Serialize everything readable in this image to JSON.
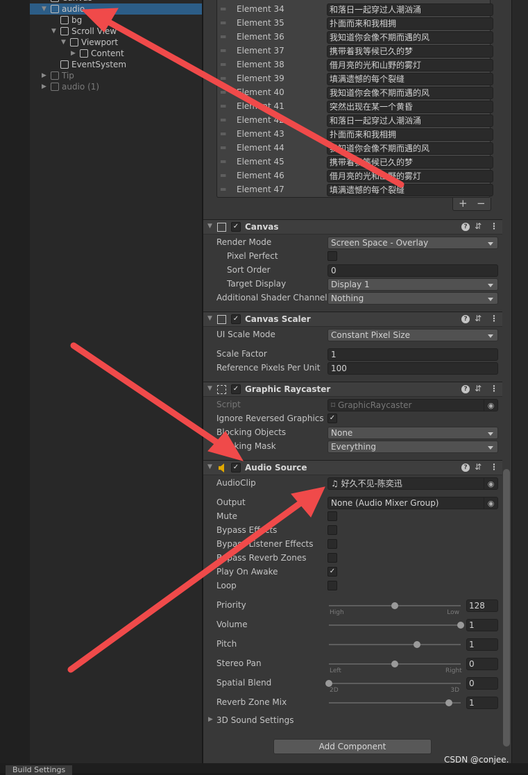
{
  "hierarchy": {
    "items": [
      {
        "label": "Canvas",
        "depth": 0,
        "fold": "open",
        "dim": false
      },
      {
        "label": "audio",
        "depth": 0,
        "fold": "open",
        "selected": true,
        "dim": false
      },
      {
        "label": "bg",
        "depth": 1,
        "fold": "none",
        "dim": false
      },
      {
        "label": "Scroll View",
        "depth": 1,
        "fold": "open",
        "dim": false
      },
      {
        "label": "Viewport",
        "depth": 2,
        "fold": "open",
        "dim": false
      },
      {
        "label": "Content",
        "depth": 3,
        "fold": "closed",
        "dim": false
      },
      {
        "label": "EventSystem",
        "depth": 1,
        "fold": "none",
        "dim": false
      },
      {
        "label": "Tip",
        "depth": 0,
        "fold": "closed",
        "dim": true
      },
      {
        "label": "audio (1)",
        "depth": 0,
        "fold": "closed",
        "dim": true
      }
    ]
  },
  "list": {
    "elements": [
      {
        "label": "Element 34",
        "value": "和落日一起穿过人潮汹涌"
      },
      {
        "label": "Element 35",
        "value": "扑面而来和我相拥"
      },
      {
        "label": "Element 36",
        "value": "我知道你会像不期而遇的风"
      },
      {
        "label": "Element 37",
        "value": "携带着我等候已久的梦"
      },
      {
        "label": "Element 38",
        "value": "借月亮的光和山野的雾灯"
      },
      {
        "label": "Element 39",
        "value": "填满遗憾的每个裂缝"
      },
      {
        "label": "Element 40",
        "value": "我知道你会像不期而遇的风"
      },
      {
        "label": "Element 41",
        "value": "突然出现在某一个黄昏"
      },
      {
        "label": "Element 42",
        "value": "和落日一起穿过人潮汹涌"
      },
      {
        "label": "Element 43",
        "value": "扑面而来和我相拥"
      },
      {
        "label": "Element 44",
        "value": "我知道你会像不期而遇的风"
      },
      {
        "label": "Element 45",
        "value": "携带着我等候已久的梦"
      },
      {
        "label": "Element 46",
        "value": "借月亮的光和山野的雾灯"
      },
      {
        "label": "Element 47",
        "value": "填满遗憾的每个裂缝"
      }
    ],
    "add_label": "+",
    "remove_label": "−"
  },
  "components": [
    {
      "title": "Canvas",
      "icon": "canvas-icon",
      "enabled": true,
      "props": [
        {
          "label": "Render Mode",
          "type": "dropdown",
          "value": "Screen Space - Overlay"
        },
        {
          "label": "Pixel Perfect",
          "type": "checkbox",
          "checked": false,
          "indent": true
        },
        {
          "label": "Sort Order",
          "type": "text",
          "value": "0",
          "indent": true
        },
        {
          "label": "Target Display",
          "type": "dropdown",
          "value": "Display 1",
          "indent": true
        },
        {
          "label": "Additional Shader Channels",
          "type": "dropdown",
          "value": "Nothing"
        }
      ]
    },
    {
      "title": "Canvas Scaler",
      "icon": "canvas-scaler-icon",
      "enabled": true,
      "props": [
        {
          "label": "UI Scale Mode",
          "type": "dropdown",
          "value": "Constant Pixel Size"
        },
        {
          "label": "Scale Factor",
          "type": "text",
          "value": "1"
        },
        {
          "label": "Reference Pixels Per Unit",
          "type": "text",
          "value": "100"
        }
      ]
    },
    {
      "title": "Graphic Raycaster",
      "icon": "graphic-raycaster-icon",
      "enabled": true,
      "props": [
        {
          "label": "Script",
          "type": "object",
          "value": "⌑ GraphicRaycaster",
          "disabled": true
        },
        {
          "label": "Ignore Reversed Graphics",
          "type": "checkbox",
          "checked": true
        },
        {
          "label": "Blocking Objects",
          "type": "dropdown",
          "value": "None"
        },
        {
          "label": "Blocking Mask",
          "type": "dropdown",
          "value": "Everything"
        }
      ]
    },
    {
      "title": "Audio Source",
      "icon": "audio-source-icon",
      "enabled": true,
      "props": [
        {
          "label": "AudioClip",
          "type": "object",
          "value": "♫ 好久不见-陈奕迅"
        },
        {
          "label": "Output",
          "type": "object",
          "value": "None (Audio Mixer Group)"
        },
        {
          "label": "Mute",
          "type": "checkbox",
          "checked": false
        },
        {
          "label": "Bypass Effects",
          "type": "checkbox",
          "checked": false
        },
        {
          "label": "Bypass Listener Effects",
          "type": "checkbox",
          "checked": false
        },
        {
          "label": "Bypass Reverb Zones",
          "type": "checkbox",
          "checked": false
        },
        {
          "label": "Play On Awake",
          "type": "checkbox",
          "checked": true
        },
        {
          "label": "Loop",
          "type": "checkbox",
          "checked": false
        },
        {
          "label": "Priority",
          "type": "slider",
          "value": "128",
          "fraction": 0.5,
          "min_label": "High",
          "max_label": "Low"
        },
        {
          "label": "Volume",
          "type": "slider",
          "value": "1",
          "fraction": 1.0
        },
        {
          "label": "Pitch",
          "type": "slider",
          "value": "1",
          "fraction": 0.667
        },
        {
          "label": "Stereo Pan",
          "type": "slider",
          "value": "0",
          "fraction": 0.5,
          "min_label": "Left",
          "max_label": "Right"
        },
        {
          "label": "Spatial Blend",
          "type": "slider",
          "value": "0",
          "fraction": 0.0,
          "min_label": "2D",
          "max_label": "3D"
        },
        {
          "label": "Reverb Zone Mix",
          "type": "slider",
          "value": "1",
          "fraction": 0.909
        },
        {
          "label": "3D Sound Settings",
          "type": "foldout"
        }
      ]
    }
  ],
  "add_component_label": "Add Component",
  "bottom_tab": "Build Settings",
  "watermark": "CSDN @conjee.",
  "colors": {
    "selection": "#2c5d87",
    "annotation_arrow": "#f04a4a",
    "audio_icon": "#e0a800"
  }
}
